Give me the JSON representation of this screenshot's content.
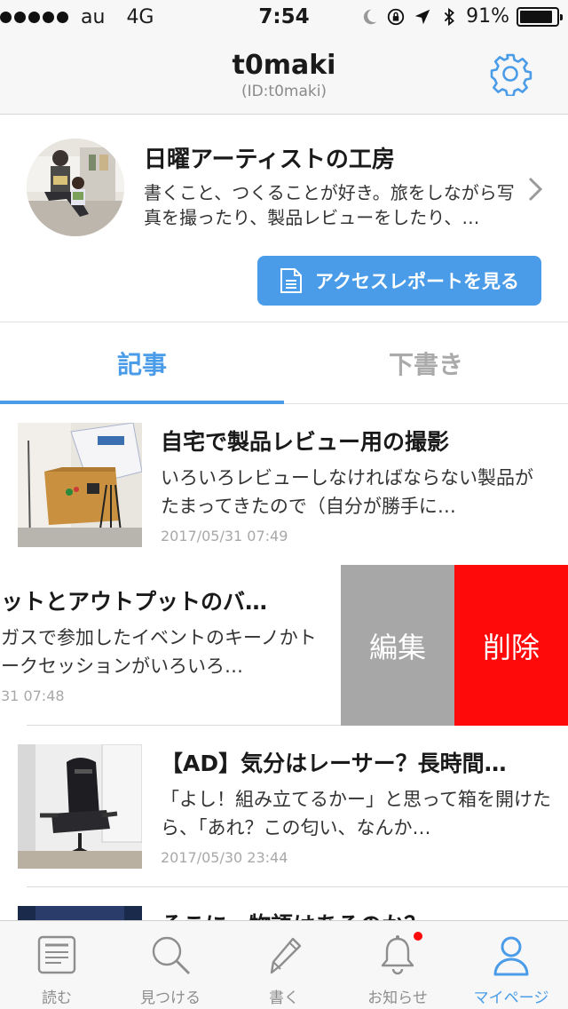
{
  "status_bar": {
    "carrier": "au",
    "network": "4G",
    "time": "7:54",
    "battery": "91%",
    "battery_level": 0.91
  },
  "header": {
    "title": "t0maki",
    "subtitle": "(ID:t0maki)",
    "settings_icon": "gear-icon",
    "accent_color": "#4a9ce8"
  },
  "profile": {
    "blog_title": "日曜アーティストの工房",
    "description": "書くこと、つくることが好き。旅をしながら写真を撮ったり、製品レビューをしたり、…",
    "access_report_label": "アクセスレポートを見る"
  },
  "tabs": [
    {
      "label": "記事",
      "active": true
    },
    {
      "label": "下書き",
      "active": false
    }
  ],
  "articles": [
    {
      "title": "自宅で製品レビュー用の撮影",
      "excerpt": "いろいろレビューしなければならない製品がたまってきたので（自分が勝手に…",
      "date": "2017/05/31 07:49"
    },
    {
      "title": "ットとアウトプットのバ…",
      "excerpt": "ガスで参加したイベントのキーノかトークセッションがいろいろ…",
      "date": "31 07:48",
      "edit_label": "編集",
      "delete_label": "削除",
      "edit_color": "#a7a7a7",
      "delete_color": "#ff0a0a"
    },
    {
      "title": "【AD】気分はレーサー？長時間…",
      "excerpt": "「よし！組み立てるかー」と思って箱を開けたら、「あれ？この匂い、なんか…",
      "date": "2017/05/30 23:44"
    },
    {
      "title": "そこに、物語はあるのか？",
      "excerpt": "",
      "date": ""
    }
  ],
  "tab_bar": [
    {
      "label": "読む",
      "icon": "reader-icon"
    },
    {
      "label": "見つける",
      "icon": "search-icon"
    },
    {
      "label": "書く",
      "icon": "pencil-icon"
    },
    {
      "label": "お知らせ",
      "icon": "bell-icon",
      "has_badge": true
    },
    {
      "label": "マイページ",
      "icon": "person-icon",
      "active": true
    }
  ]
}
